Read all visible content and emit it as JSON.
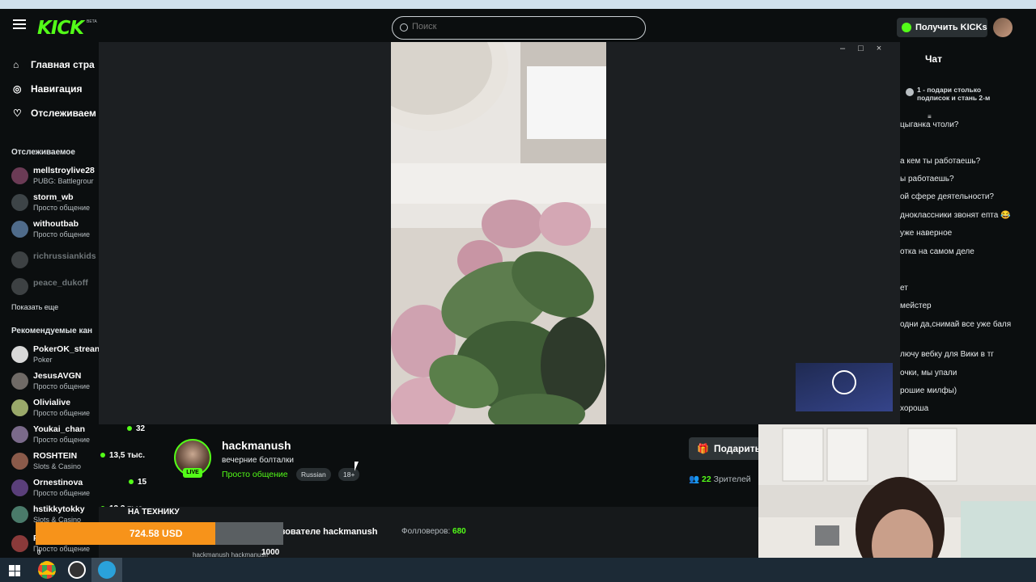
{
  "header": {
    "logo": "KICK",
    "logo_beta": "BETA",
    "search_placeholder": "Поиск",
    "get_kicks": "Получить KICKs"
  },
  "sidebar": {
    "nav": [
      {
        "label": "Главная стра",
        "icon": "home-icon"
      },
      {
        "label": "Навигация",
        "icon": "compass-icon"
      },
      {
        "label": "Отслеживаем",
        "icon": "heart-icon"
      }
    ],
    "following_title": "Отслеживаемое",
    "following": [
      {
        "name": "mellstroylive28",
        "category": "PUBG: Battlegrour"
      },
      {
        "name": "storm_wb",
        "category": "Просто общение"
      },
      {
        "name": "withoutbab",
        "category": "Просто общение"
      },
      {
        "name": "richrussiankids",
        "category": ""
      },
      {
        "name": "peace_dukoff",
        "category": ""
      }
    ],
    "show_more": "Показать еще",
    "recommended_title": "Рекомендуемые кан",
    "recommended": [
      {
        "name": "PokerOK_strean",
        "category": "Poker",
        "viewers": ""
      },
      {
        "name": "JesusAVGN",
        "category": "Просто общение",
        "viewers": ""
      },
      {
        "name": "Olivialive",
        "category": "Просто общение",
        "viewers": ""
      },
      {
        "name": "Youkai_chan",
        "category": "Просто общение",
        "viewers": "32"
      },
      {
        "name": "ROSHTEIN",
        "category": "Slots & Casino",
        "viewers": "13,5 тыс."
      },
      {
        "name": "Ornestinova",
        "category": "Просто общение",
        "viewers": "15"
      },
      {
        "name": "hstikkytokky",
        "category": "Slots & Casino",
        "viewers": "13,3 тыс."
      },
      {
        "name": "P",
        "category": "Просто общение",
        "viewers": ""
      }
    ]
  },
  "video": {
    "window_controls": "–□×"
  },
  "chat": {
    "title": "Чат",
    "pinned": "1 - подари столько подписок и стань 2-м",
    "lines": [
      "цыганка чтоли?",
      "а кем ты работаешь?",
      "ы работаешь?",
      "ой сфере деятельности?",
      "дноклассники звонят епта 😂",
      "уже наверное",
      "отка на самом деле",
      "ет",
      "мейстер",
      "одни да,снимай все уже баля",
      "лючу вебку для Вики в тг",
      "очки, мы упали",
      "рошие милфы)",
      "хороша"
    ]
  },
  "stream": {
    "name": "hackmanush",
    "title": "вечерние болталки",
    "category": "Просто общение",
    "tags": [
      "Russian",
      "18+"
    ],
    "live": "LIVE",
    "gift_label": "Подарить",
    "viewers_count": "22",
    "viewers_label": "Зрителей"
  },
  "about": {
    "text": "зователе hackmanush",
    "followers_label": "Фолловеров:",
    "followers_count": "680",
    "cutoff": "hackmanush            hackmanush"
  },
  "donation": {
    "title": "НА ТЕХНИКУ",
    "amount": "724.58 USD",
    "progress": 0.7246,
    "min": "0",
    "max": "1000"
  },
  "colors": {
    "brand": "#53fc18",
    "donation": "#f7931a"
  }
}
